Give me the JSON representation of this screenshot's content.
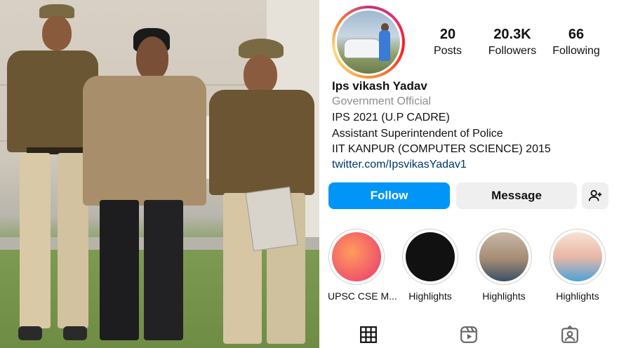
{
  "profile": {
    "name": "Ips vikash Yadav",
    "category": "Government Official",
    "bio": [
      "IPS 2021 (U.P CADRE)",
      "Assistant Superintendent of Police",
      "IIT KANPUR (COMPUTER SCIENCE) 2015"
    ],
    "link": "twitter.com/IpsvikasYadav1"
  },
  "stats": [
    {
      "value": "20",
      "label": "Posts"
    },
    {
      "value": "20.3K",
      "label": "Followers"
    },
    {
      "value": "66",
      "label": "Following"
    }
  ],
  "buttons": {
    "follow": "Follow",
    "message": "Message"
  },
  "highlights": [
    {
      "label": "UPSC CSE M..."
    },
    {
      "label": "Highlights"
    },
    {
      "label": "Highlights"
    },
    {
      "label": "Highlights"
    }
  ],
  "icons": {
    "add_person": "add-person-icon",
    "grid": "grid-icon",
    "reels": "reels-icon",
    "tagged": "tagged-icon"
  },
  "colors": {
    "follow_button": "#0095f6",
    "link": "#00376b",
    "category": "#8e8e8e"
  }
}
